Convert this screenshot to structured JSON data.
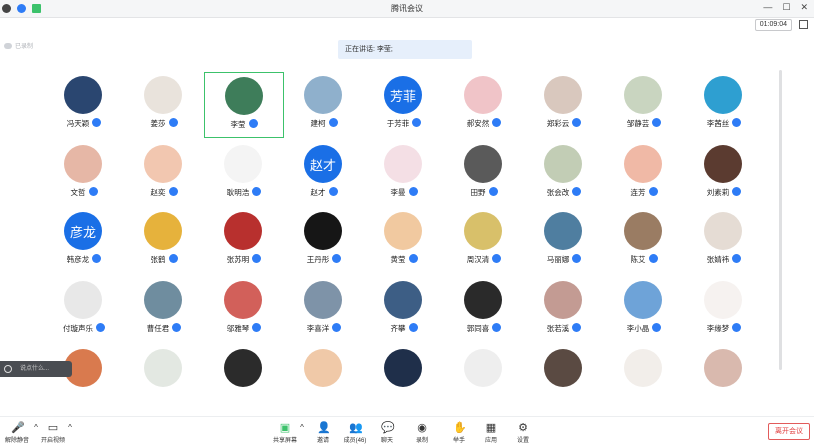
{
  "window": {
    "title": "腾讯会议",
    "min": "—",
    "max": "☐",
    "close": "✕"
  },
  "header": {
    "timer": "01:09:04",
    "cloud_status": "已录制",
    "speaking_label": "正在讲话: 李莹;"
  },
  "colors": {
    "accent": "#1a6fe6",
    "active_speaker": "#3cc26b",
    "danger": "#e03c3c"
  },
  "grid": [
    [
      {
        "name": "冯天颖",
        "avatar": "photo",
        "color": "#2a4670"
      },
      {
        "name": "姜莎",
        "avatar": "photo",
        "color": "#e9e3dc"
      },
      {
        "name": "李莹",
        "avatar": "photo",
        "color": "#3e7d5a",
        "active": true
      },
      {
        "name": "建柯",
        "avatar": "photo",
        "color": "#8fb0cc",
        "host": true
      },
      {
        "name": "于芳菲",
        "avatar": "text",
        "text": "芳菲"
      },
      {
        "name": "郝安然",
        "avatar": "photo",
        "color": "#f0c4c8"
      },
      {
        "name": "郑彩云",
        "avatar": "photo",
        "color": "#d9c8be"
      },
      {
        "name": "邹静芸",
        "avatar": "photo",
        "color": "#c9d5c0"
      },
      {
        "name": "李茜丝",
        "avatar": "photo",
        "color": "#2e9fd1"
      }
    ],
    [
      {
        "name": "文哲",
        "avatar": "photo",
        "color": "#e6b7a6"
      },
      {
        "name": "赵奕",
        "avatar": "photo",
        "color": "#f2c7b0"
      },
      {
        "name": "耿明浩",
        "avatar": "photo",
        "color": "#f4f4f4"
      },
      {
        "name": "赵才",
        "avatar": "text",
        "text": "赵才"
      },
      {
        "name": "李曼",
        "avatar": "photo",
        "color": "#f4dfe5"
      },
      {
        "name": "田野",
        "avatar": "photo",
        "color": "#5a5a5a"
      },
      {
        "name": "张会改",
        "avatar": "photo",
        "color": "#c2cdb5"
      },
      {
        "name": "连芳",
        "avatar": "photo",
        "color": "#f0b9a6"
      },
      {
        "name": "刘素莉",
        "avatar": "photo",
        "color": "#5b3b30"
      }
    ],
    [
      {
        "name": "韩彦龙",
        "avatar": "text",
        "text": "彦龙"
      },
      {
        "name": "张鹤",
        "avatar": "photo",
        "color": "#e6b23c"
      },
      {
        "name": "张苏明",
        "avatar": "photo",
        "color": "#b8302e"
      },
      {
        "name": "王丹彤",
        "avatar": "photo",
        "color": "#161616"
      },
      {
        "name": "黄莹",
        "avatar": "photo",
        "color": "#f1c9a0"
      },
      {
        "name": "周汉清",
        "avatar": "photo",
        "color": "#d8c06a"
      },
      {
        "name": "马丽娜",
        "avatar": "photo",
        "color": "#4f7ea0"
      },
      {
        "name": "陈艾",
        "avatar": "photo",
        "color": "#9a7c63"
      },
      {
        "name": "张婧祎",
        "avatar": "photo",
        "color": "#e5dcd4"
      }
    ],
    [
      {
        "name": "付璇声乐",
        "avatar": "photo",
        "color": "#e8e8e8"
      },
      {
        "name": "曹任君",
        "avatar": "photo",
        "color": "#6f8d9f"
      },
      {
        "name": "邬雅琴",
        "avatar": "photo",
        "color": "#d2605a"
      },
      {
        "name": "李喜洋",
        "avatar": "photo",
        "color": "#7e93a8"
      },
      {
        "name": "齐攀",
        "avatar": "photo",
        "color": "#3d5e85"
      },
      {
        "name": "郭同喜",
        "avatar": "photo",
        "color": "#2a2a2a"
      },
      {
        "name": "张若溪",
        "avatar": "photo",
        "color": "#c39b93"
      },
      {
        "name": "李小晶",
        "avatar": "photo",
        "color": "#6ea3d8"
      },
      {
        "name": "李缘梦",
        "avatar": "photo",
        "color": "#f6f2f0"
      }
    ],
    [
      {
        "name": "",
        "avatar": "photo",
        "color": "#d97a4e"
      },
      {
        "name": "",
        "avatar": "photo",
        "color": "#e3e8e2"
      },
      {
        "name": "",
        "avatar": "photo",
        "color": "#2b2b2b"
      },
      {
        "name": "",
        "avatar": "photo",
        "color": "#f0c9a8"
      },
      {
        "name": "",
        "avatar": "photo",
        "color": "#1f2f4a"
      },
      {
        "name": "",
        "avatar": "photo",
        "color": "#eeeeee"
      },
      {
        "name": "",
        "avatar": "photo",
        "color": "#5a4a42"
      },
      {
        "name": "",
        "avatar": "photo",
        "color": "#f2eeea"
      },
      {
        "name": "",
        "avatar": "photo",
        "color": "#d9b9ae"
      }
    ]
  ],
  "chat": {
    "placeholder": "说点什么..."
  },
  "toolbar": {
    "unmute": "解除静音",
    "start_video": "开启视频",
    "share_screen": "共享屏幕",
    "invite": "邀请",
    "members": "成员(46)",
    "chat": "聊天",
    "record": "录制",
    "raise_hand": "举手",
    "apps": "应用",
    "settings": "设置",
    "leave": "离开会议"
  }
}
